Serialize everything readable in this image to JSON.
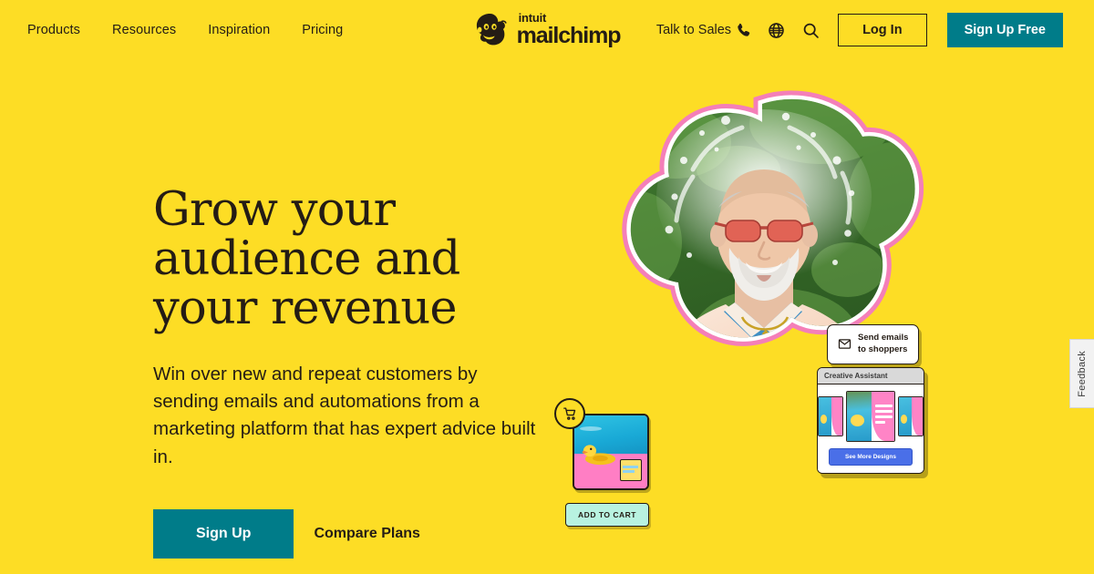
{
  "theme": {
    "background": "#FDDD25",
    "text": "#241C15",
    "teal": "#007C89",
    "pink": "#F47FB8",
    "mint": "#B8F2E0",
    "blue": "#4A6FE8"
  },
  "header": {
    "nav": [
      {
        "label": "Products"
      },
      {
        "label": "Resources"
      },
      {
        "label": "Inspiration"
      },
      {
        "label": "Pricing"
      }
    ],
    "logo": {
      "mark": "freddie-monkey-icon",
      "intuit": "intuit",
      "mailchimp": "mailchimp"
    },
    "talk_to_sales": "Talk to Sales",
    "icons": {
      "phone": "phone-icon",
      "globe": "globe-icon",
      "search": "search-icon"
    },
    "login_label": "Log In",
    "signup_free_label": "Sign Up Free"
  },
  "hero": {
    "title": "Grow your audience and your revenue",
    "subtitle": "Win over new and repeat customers by sending emails and automations from a marketing platform that has expert advice built in.",
    "signup_label": "Sign Up",
    "compare_label": "Compare Plans"
  },
  "hero_art": {
    "photo_alt": "man-with-sunglasses-splash-photo",
    "cart_icon": "shopping-cart-icon",
    "add_to_cart_label": "ADD TO CART",
    "email_card": {
      "icon": "envelope-icon",
      "text": "Send emails\nto shoppers"
    },
    "creative_assistant": {
      "title": "Creative Assistant",
      "button_label": "See More Designs"
    }
  },
  "feedback": {
    "label": "Feedback"
  }
}
